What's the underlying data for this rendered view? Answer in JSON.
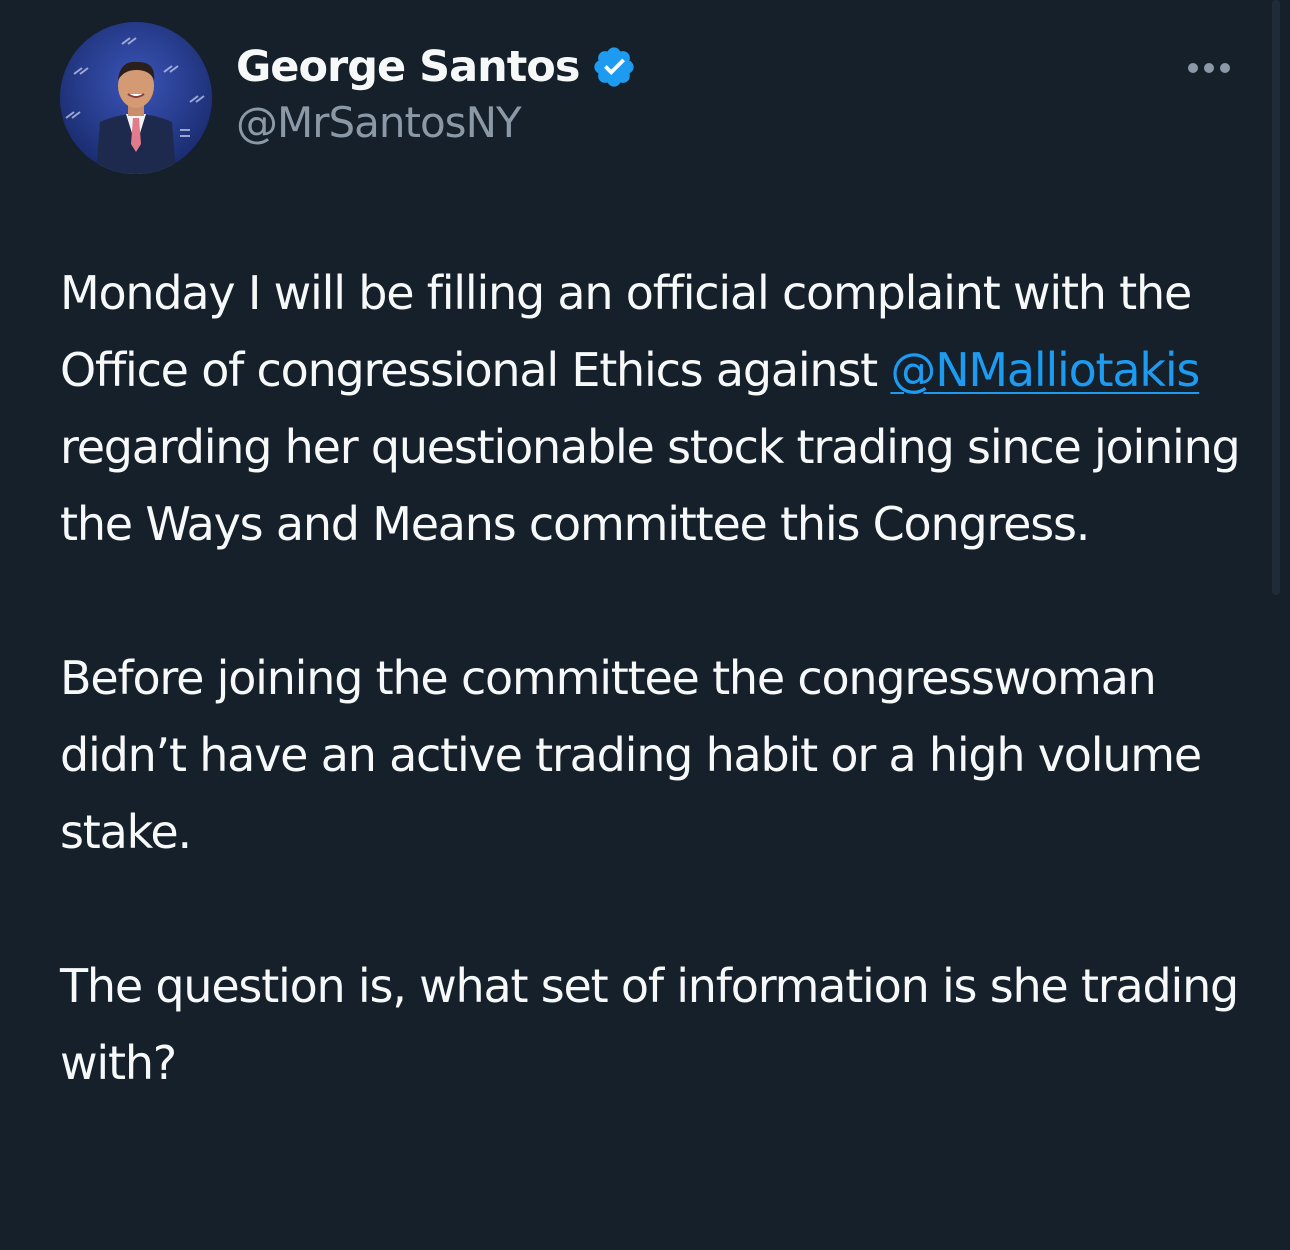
{
  "author": {
    "display_name": "George Santos",
    "handle": "@MrSantosNY",
    "avatar_icon": "profile-photo",
    "verified_icon": "verified-badge-icon",
    "verified_color": "#1d9bf0"
  },
  "more_icon": "more-options-icon",
  "tweet": {
    "para1": {
      "before_mention": "Monday I will be filling an official complaint with the Office of congressional Ethics against ",
      "mention": "@NMalliotakis",
      "after_mention": " regarding her questionable stock trading since joining the Ways and Means committee this Congress."
    },
    "para2": "Before joining the committee the congresswoman didn’t have an active trading habit or a high volume stake.",
    "para3": "The question is, what set of information is she trading with?"
  },
  "colors": {
    "background": "#15202b",
    "text": "#f7f9f9",
    "secondary_text": "#8b98a5",
    "link": "#1d9bf0"
  }
}
